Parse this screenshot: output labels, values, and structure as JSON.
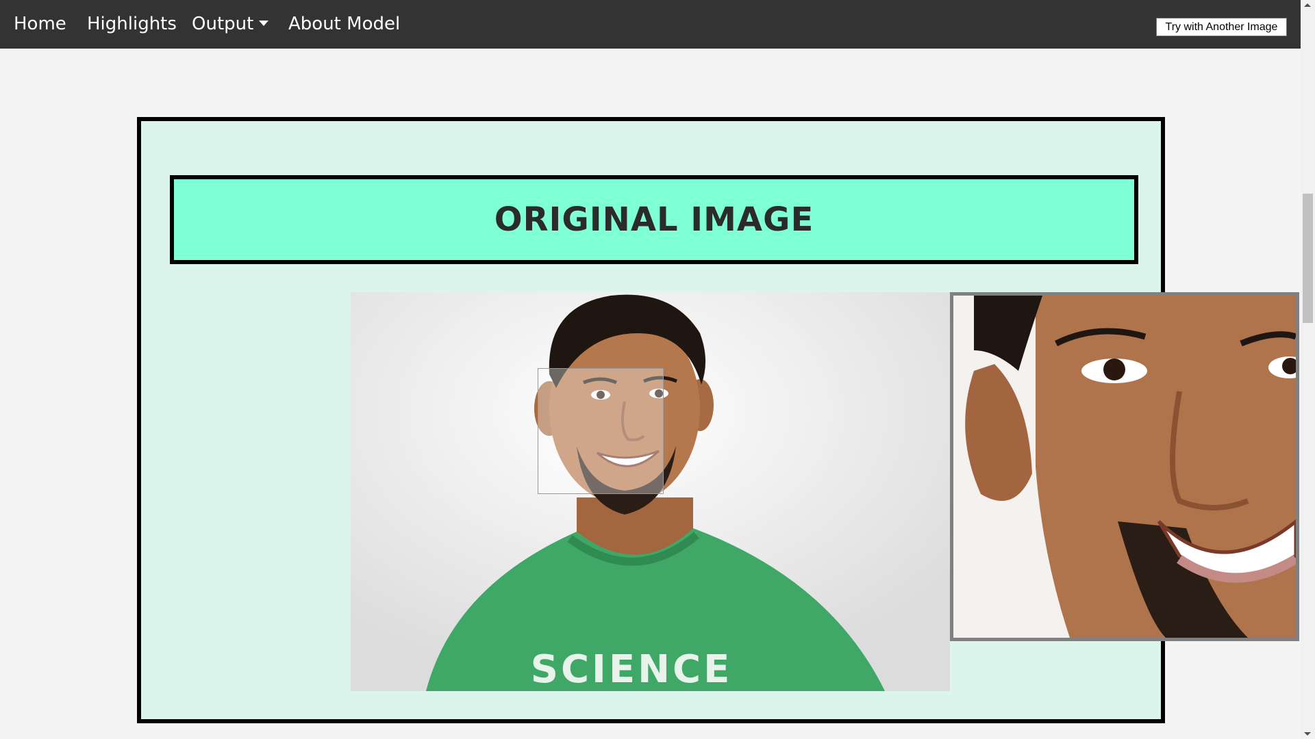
{
  "nav": {
    "items": [
      {
        "label": "Home"
      },
      {
        "label": "Highlights"
      },
      {
        "label": "Output"
      },
      {
        "label": "About Model"
      }
    ],
    "action_button": "Try with Another Image"
  },
  "section": {
    "title": "ORIGINAL IMAGE"
  },
  "photo": {
    "alt": "Smiling man in green t-shirt",
    "shirt_text": "SCIENCE"
  },
  "colors": {
    "navbar": "#333333",
    "panel_bg": "#dbf5ec",
    "title_bg": "#7fffd4",
    "shirt": "#3fa866"
  }
}
